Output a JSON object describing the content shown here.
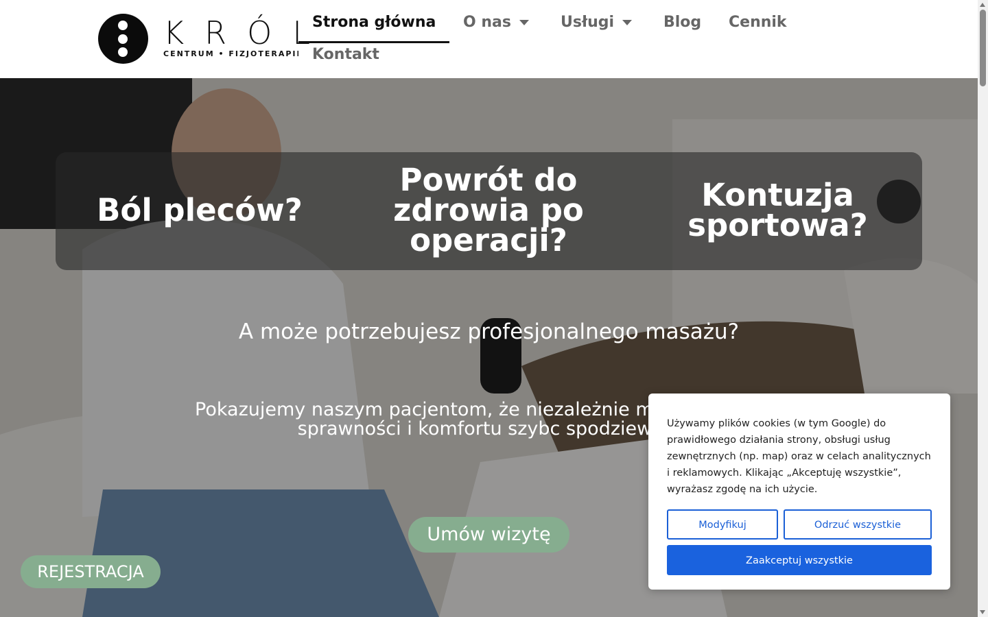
{
  "header": {
    "logo": {
      "word": "KRÓL",
      "tagline": "CENTRUM • FIZJOTERAPII"
    },
    "nav": [
      {
        "label": "Strona główna",
        "active": true,
        "dropdown": false
      },
      {
        "label": "O nas",
        "active": false,
        "dropdown": true
      },
      {
        "label": "Usługi",
        "active": false,
        "dropdown": true
      },
      {
        "label": "Blog",
        "active": false,
        "dropdown": false
      },
      {
        "label": "Cennik",
        "active": false,
        "dropdown": false
      },
      {
        "label": "Kontakt",
        "active": false,
        "dropdown": false
      }
    ]
  },
  "hero": {
    "banner": {
      "left": "Ból pleców?",
      "center": "Powrót do zdrowia po operacji?",
      "right": "Kontuzja sportowa?"
    },
    "subheading": "A może potrzebujesz profesjonalnego masażu?",
    "paragraph": "Pokazujemy naszym pacjentom, że niezależnie mogą wrócić do sprawności i komfortu szybc spodziewali.",
    "cta_label": "Umów wizytę"
  },
  "register_label": "REJESTRACJA",
  "cookie": {
    "text": "Używamy plików cookies (w tym Google) do prawidłowego działania strony, obsługi usług zewnętrznych (np. map) oraz w celach analitycznych i reklamowych. Klikając „Akceptuję wszystkie”, wyrażasz zgodę na ich użycie.",
    "modify_label": "Modyfikuj",
    "reject_label": "Odrzuć wszystkie",
    "accept_label": "Zaakceptuj wszystkie"
  },
  "colors": {
    "accent_green": "#86ad8f",
    "cookie_blue": "#1a62de",
    "nav_active": "#111111",
    "nav_inactive": "#666666"
  }
}
